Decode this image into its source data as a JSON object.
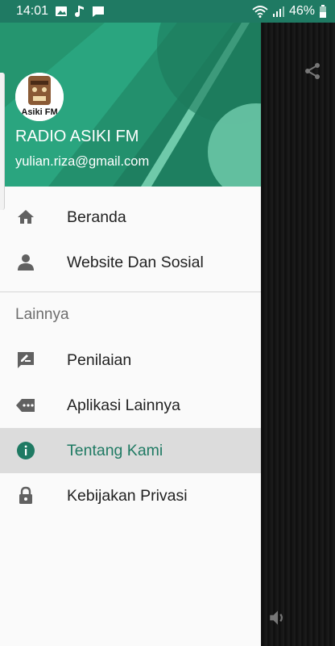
{
  "status_bar": {
    "time": "14:01",
    "battery": "46%"
  },
  "drawer": {
    "title": "RADIO ASIKI FM",
    "email": "yulian.riza@gmail.com",
    "avatar_text": "Asiki FM",
    "items": [
      {
        "label": "Beranda",
        "icon": "home-icon"
      },
      {
        "label": "Website Dan Sosial",
        "icon": "person-icon"
      }
    ],
    "section_title": "Lainnya",
    "more_items": [
      {
        "label": "Penilaian",
        "icon": "rate-review-icon"
      },
      {
        "label": "Aplikasi Lainnya",
        "icon": "more-apps-icon"
      },
      {
        "label": "Tentang Kami",
        "icon": "info-icon",
        "active": true
      },
      {
        "label": "Kebijakan Privasi",
        "icon": "lock-icon"
      }
    ]
  },
  "colors": {
    "primary": "#1f7a63",
    "header_green": "#2aa57f",
    "active_bg": "#dcdcdc"
  }
}
